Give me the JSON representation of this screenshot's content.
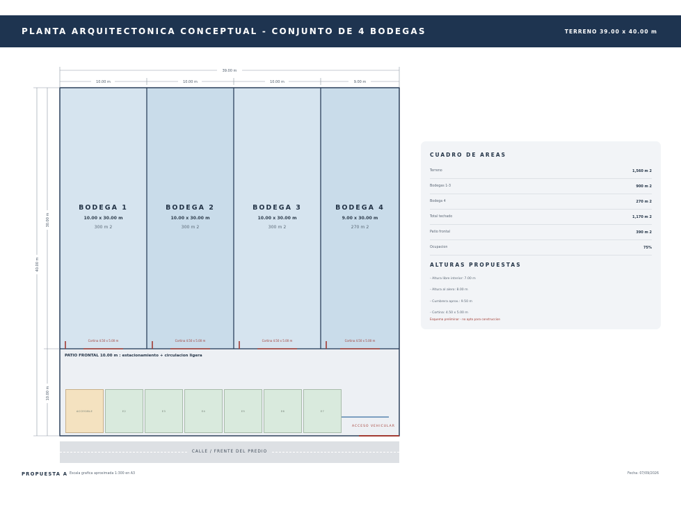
{
  "header": {
    "title": "PLANTA ARQUITECTONICA CONCEPTUAL - CONJUNTO DE 4 BODEGAS",
    "terreno": "TERRENO 39.00 x 40.00 m"
  },
  "plan": {
    "dim_total_width": "39.00 m",
    "dim_widths": [
      "10.00 m",
      "10.00 m",
      "10.00 m",
      "9.00 m"
    ],
    "dim_total_depth": "40.00 m",
    "dim_bodega_depth": "30.00 m",
    "dim_patio_depth": "10.00 m",
    "bodegas": [
      {
        "name": "BODEGA 1",
        "dims": "10.00 x 30.00 m",
        "area": "300 m 2",
        "cortina": "Cortina 4.50 x 5.00 m",
        "color": "#d6e4ef"
      },
      {
        "name": "BODEGA 2",
        "dims": "10.00 x 30.00 m",
        "area": "300 m 2",
        "cortina": "Cortina 4.50 x 5.00 m",
        "color": "#c9dcea"
      },
      {
        "name": "BODEGA 3",
        "dims": "10.00 x 30.00 m",
        "area": "300 m 2",
        "cortina": "Cortina 4.50 x 5.00 m",
        "color": "#d6e4ef"
      },
      {
        "name": "BODEGA 4",
        "dims": "9.00 x 30.00 m",
        "area": "270 m 2",
        "cortina": "Cortina 4.50 x 5.00 m",
        "color": "#c9dcea"
      }
    ],
    "patio_label": "PATIO FRONTAL 10.00 m : estacionamiento + circulacion ligera",
    "stalls": [
      "ACCESIBLE",
      "E2",
      "E3",
      "E4",
      "E5",
      "E6",
      "E7"
    ],
    "acceso": "ACCESO VEHICULAR",
    "street": "CALLE / FRENTE DEL PREDIO"
  },
  "panel": {
    "areas_title": "CUADRO DE AREAS",
    "areas": [
      {
        "label": "Terreno",
        "value": "1,560 m 2"
      },
      {
        "label": "Bodegas 1-3",
        "value": "900 m 2"
      },
      {
        "label": "Bodega 4",
        "value": "270 m 2"
      },
      {
        "label": "Total techado",
        "value": "1,170 m 2"
      },
      {
        "label": "Patio frontal",
        "value": "390 m 2"
      },
      {
        "label": "Ocupacion",
        "value": "75%"
      }
    ],
    "alturas_title": "ALTURAS PROPUESTAS",
    "alturas": [
      "- Altura libre interior: 7.00 m",
      "- Altura al alero: 8.00 m",
      "- Cumbrera aprox.: 9.50 m",
      "- Cortina: 4.50 x 5.00 m"
    ],
    "note": "Esquema preliminar - no apto para construccion"
  },
  "footer": {
    "proposal": "PROPUESTA A",
    "scale": "Escala grafica aproximada 1:300 en A3",
    "date": "Fecha: 07/09/2026"
  },
  "colors": {
    "header_bg": "#1e3450",
    "plan_outline": "#1e3450",
    "patio_bg": "#edf0f4",
    "cortina_red": "#a23a32",
    "stall_green": "#d9eadd",
    "stall_accessible": "#f4e2c0"
  }
}
